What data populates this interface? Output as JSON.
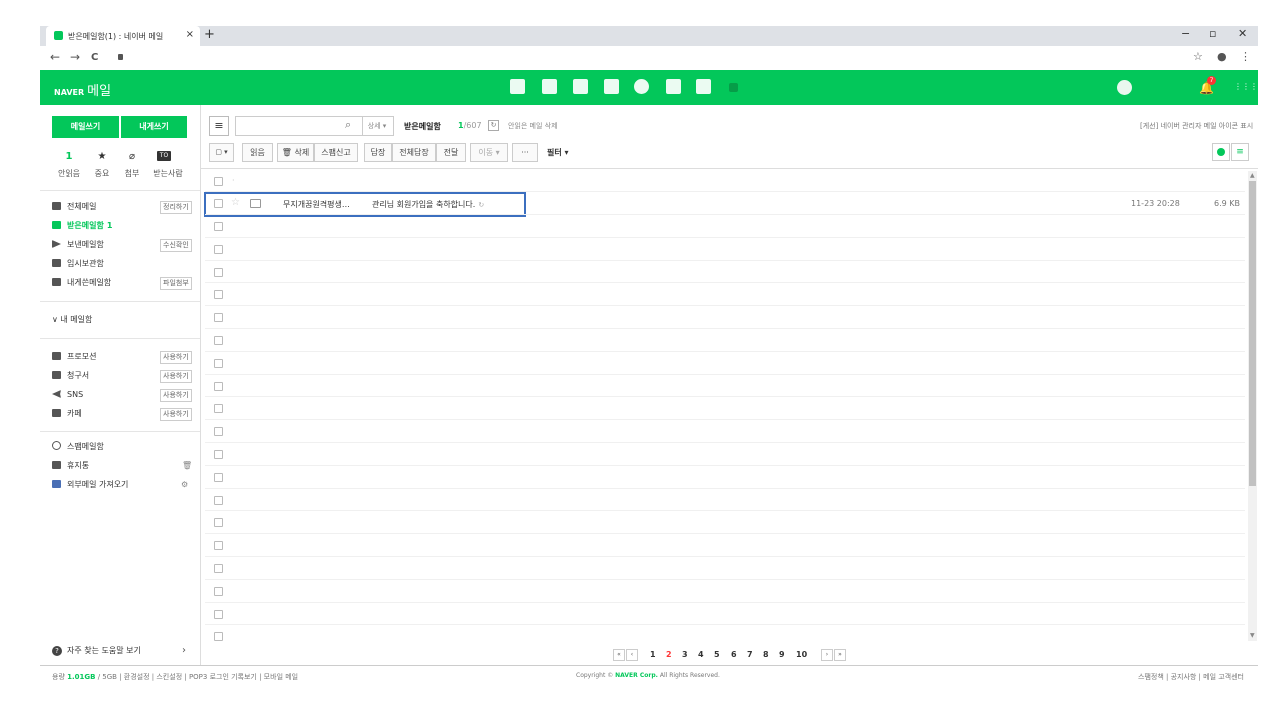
{
  "browser": {
    "tab_title": "받은메일함(1) : 네이버 메일",
    "tab_close": "×",
    "new_tab": "+",
    "win_min": "−",
    "win_max": "▫",
    "win_close": "✕",
    "back": "←",
    "forward": "→",
    "reload": "C",
    "bookmark": "☆",
    "profile": "●",
    "menu": "⋮"
  },
  "header": {
    "logo": "NAVER",
    "service": "메일",
    "notification_count": "7",
    "apps_icon": "⋮⋮⋮"
  },
  "sidebar": {
    "write_button": "메일쓰기",
    "self_button": "내게쓰기",
    "quick": [
      {
        "icon": "1",
        "label": "안읽음"
      },
      {
        "icon": "★",
        "label": "중요"
      },
      {
        "icon": "⌀",
        "label": "첨부"
      },
      {
        "icon": "TO",
        "label": "받는사람"
      }
    ],
    "folders": [
      {
        "label": "전체메일",
        "pill": "정리하기"
      },
      {
        "label": "받은메일함",
        "count": "1"
      },
      {
        "label": "보낸메일함",
        "pill": "수신확인"
      },
      {
        "label": "임시보관함"
      },
      {
        "label": "내게쓴메일함",
        "pill": "파일첨부"
      }
    ],
    "my_mailbox": "∨ 내 메일함",
    "smart": [
      {
        "label": "프로모션",
        "pill": "사용하기"
      },
      {
        "label": "청구서",
        "pill": "사용하기"
      },
      {
        "label": "SNS",
        "pill": "사용하기"
      },
      {
        "label": "카페",
        "pill": "사용하기"
      }
    ],
    "extra": [
      {
        "label": "스팸메일함"
      },
      {
        "label": "휴지통"
      },
      {
        "label": "외부메일 가져오기"
      }
    ],
    "faq": "자주 찾는 도움말 보기",
    "faq_arrow": "›"
  },
  "toolbar": {
    "menu_icon": "≡",
    "detail": "상세 ▾",
    "box_title": "받은메일함",
    "unread": "1",
    "total": "/607",
    "unread_delete": "안읽은 메일 삭제",
    "top_right": "[게선] 네이버 관리자 메일 아이콘 표시",
    "buttons": [
      "읽음",
      "🗑 삭제",
      "스팸신고",
      "답장",
      "전체답장",
      "전달",
      "이동 ▾",
      "···"
    ],
    "filter": "필터 ▾",
    "view_list": "≡"
  },
  "mail": {
    "sender": "무지개꿈원격평생…",
    "subject": "관리님 회원가입을 축하합니다.",
    "date": "11-23 20:28",
    "size": "6.9 KB"
  },
  "pagination": {
    "first": "«",
    "prev": "‹",
    "pages": [
      "1",
      "2",
      "3",
      "4",
      "5",
      "6",
      "7",
      "8",
      "9",
      "10"
    ],
    "current": "2",
    "next": "›",
    "last": "»"
  },
  "footer": {
    "usage_label": "용량",
    "usage_value": "1.01GB",
    "usage_total": "/ 5GB",
    "links_left": "| 환경설정 | 스킨설정 | POP3 로그인 기록보기 | 모바일 메일",
    "copyright_prefix": "Copyright ©",
    "copyright_corp": "NAVER Corp.",
    "copyright_suffix": "All Rights Reserved.",
    "links_right": "스팸정책 | 공지사항 | 메일 고객센터"
  }
}
